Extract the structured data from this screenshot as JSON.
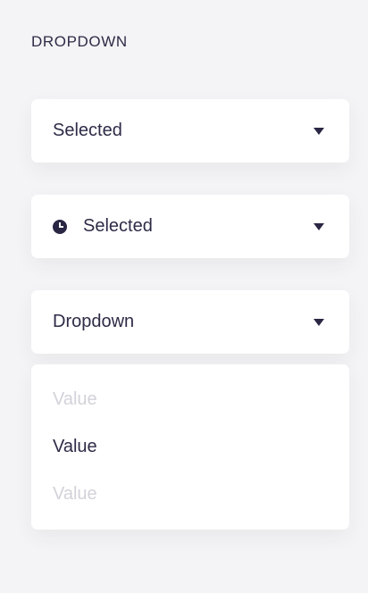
{
  "section": {
    "title": "DROPDOWN"
  },
  "dropdowns": [
    {
      "label": "Selected",
      "icon": "caret-down-icon"
    },
    {
      "label": "Selected",
      "leading_icon": "clock-icon",
      "icon": "caret-down-icon"
    },
    {
      "label": "Dropdown",
      "icon": "caret-down-icon",
      "open": true
    }
  ],
  "menu": {
    "options": [
      {
        "label": "Value",
        "state": "muted"
      },
      {
        "label": "Value",
        "state": "active"
      },
      {
        "label": "Value",
        "state": "muted"
      }
    ]
  },
  "colors": {
    "background": "#f4f4f6",
    "surface": "#ffffff",
    "text": "#2e2b47",
    "muted_text": "#d3d2da"
  }
}
